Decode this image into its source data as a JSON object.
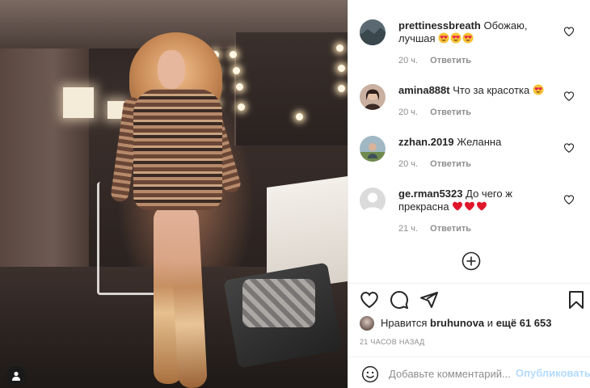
{
  "photo": {
    "alt_subject": "woman in sequined bodysuit and gold boots in a backstage dressing room"
  },
  "comments": [
    {
      "username": "prettinessbreath",
      "text": "Обожаю, лучшая",
      "emojis": [
        "heart-eyes-emoji",
        "heart-eyes-emoji",
        "heart-eyes-emoji"
      ],
      "time": "20 ч.",
      "reply_label": "Ответить",
      "avatar_icon": "landscape-avatar"
    },
    {
      "username": "amina888t",
      "text": "Что за красотка",
      "emojis": [
        "heart-eyes-emoji"
      ],
      "time": "20 ч.",
      "reply_label": "Ответить",
      "avatar_icon": "portrait-avatar"
    },
    {
      "username": "zzhan.2019",
      "text": "Желанна",
      "emojis": [],
      "time": "20 ч.",
      "reply_label": "Ответить",
      "avatar_icon": "outdoor-avatar"
    },
    {
      "username": "ge.rman5323",
      "text": "До чего ж прекрасна",
      "emojis": [
        "red-heart-emoji",
        "red-heart-emoji",
        "red-heart-emoji"
      ],
      "time": "21 ч.",
      "reply_label": "Ответить",
      "avatar_icon": "default-avatar"
    }
  ],
  "likes": {
    "prefix": "Нравится",
    "user": "bruhunova",
    "connector": "и",
    "others": "ещё 61 653"
  },
  "time_ago": "21 ЧАСОВ НАЗАД",
  "comment_box": {
    "placeholder": "Добавьте комментарий...",
    "publish_label": "Опубликовать"
  },
  "colors": {
    "text": "#262626",
    "muted": "#8e8e8e",
    "publish_disabled": "#b3dbff",
    "divider": "#efefef"
  }
}
